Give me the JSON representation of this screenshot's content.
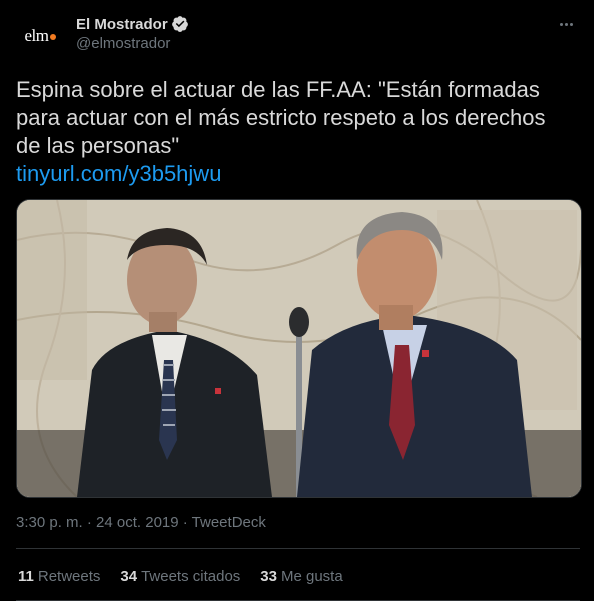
{
  "tweet": {
    "avatar_text": "elm",
    "display_name": "El Mostrador",
    "handle": "@elmostrador",
    "text": "Espina sobre el actuar de las FF.AA: \"Están formadas para actuar con el más estricto respeto a los derechos de las personas\"",
    "link": "tinyurl.com/y3b5hjwu",
    "timestamp": "3:30 p. m. · 24 oct. 2019 · ",
    "source": "TweetDeck"
  },
  "stats": {
    "retweets_count": "11",
    "retweets_label": "Retweets",
    "quotes_count": "34",
    "quotes_label": "Tweets citados",
    "likes_count": "33",
    "likes_label": "Me gusta"
  },
  "icons": {
    "verified": "verified-badge-icon",
    "more": "more-options-icon"
  },
  "colors": {
    "background": "#000000",
    "link": "#1d9bf0",
    "secondary_text": "#6e767d",
    "avatar_accent": "#f27b21"
  }
}
